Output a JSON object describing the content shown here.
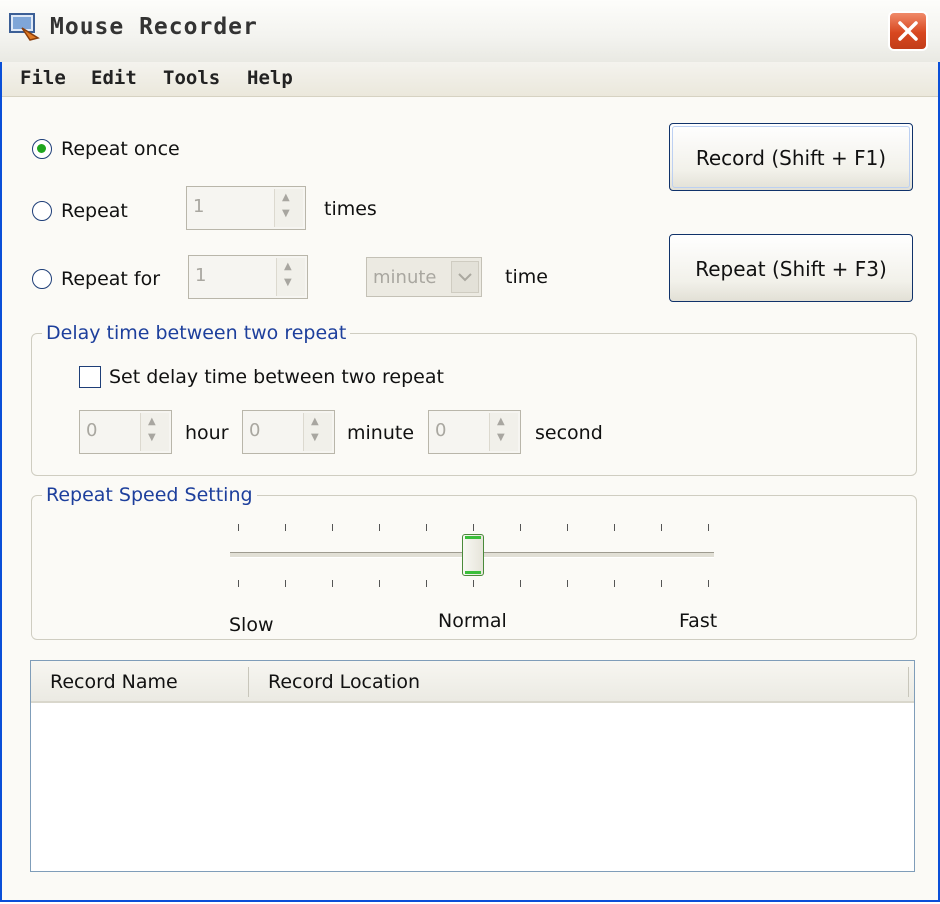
{
  "window": {
    "title": "Mouse Recorder"
  },
  "menu": [
    {
      "label": "File"
    },
    {
      "label": "Edit"
    },
    {
      "label": "Tools"
    },
    {
      "label": "Help"
    }
  ],
  "repeat_options": {
    "once_label": "Repeat once",
    "times_label": "Repeat",
    "times_value": "1",
    "times_unit": "times",
    "for_label": "Repeat for",
    "for_value": "1",
    "for_unit_selected": "minute",
    "for_suffix": "time",
    "selected": "once"
  },
  "buttons": {
    "record": "Record (Shift + F1)",
    "repeat": "Repeat (Shift + F3)"
  },
  "delay": {
    "group_title": "Delay time between two repeat",
    "checkbox_label": "Set delay time between two repeat",
    "checked": false,
    "hour_value": "0",
    "hour_label": "hour",
    "minute_value": "0",
    "minute_label": "minute",
    "second_value": "0",
    "second_label": "second"
  },
  "speed": {
    "group_title": "Repeat Speed Setting",
    "slow_label": "Slow",
    "normal_label": "Normal",
    "fast_label": "Fast",
    "position": 0.5
  },
  "records": {
    "columns": [
      "Record Name",
      "Record Location"
    ],
    "rows": []
  }
}
